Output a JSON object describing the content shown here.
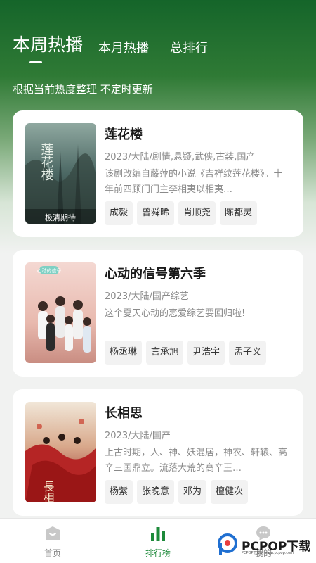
{
  "tabs": [
    {
      "label": "本周热播",
      "active": true
    },
    {
      "label": "本月热播",
      "active": false
    },
    {
      "label": "总排行",
      "active": false
    }
  ],
  "subtitle": "根据当前热度整理 不定时更新",
  "cards": [
    {
      "title": "莲花楼",
      "meta": "2023/大陆/剧情,悬疑,武侠,古装,国产",
      "desc": "        该剧改编自藤萍的小说《吉祥纹莲花楼》。十年前四顾门门主李相夷以相夷…",
      "tags": [
        "成毅",
        "曾舜晞",
        "肖顺尧",
        "陈都灵"
      ],
      "poster_text": [
        "莲花楼",
        "极清期待"
      ]
    },
    {
      "title": "心动的信号第六季",
      "meta": "2023/大陆/国产综艺",
      "desc": "这个夏天心动的恋爱综艺要回归啦!",
      "tags": [
        "杨丞琳",
        "言承旭",
        "尹浩宇",
        "孟子义"
      ],
      "poster_text": [
        "心动的信号"
      ]
    },
    {
      "title": "长相思",
      "meta": "2023/大陆/国产",
      "desc": "上古时期，人、神、妖混居，神农、轩辕、高辛三国鼎立。流落大荒的高辛王…",
      "tags": [
        "杨紫",
        "张晚意",
        "邓为",
        "檀健次"
      ],
      "poster_text": [
        "長相思"
      ]
    }
  ],
  "nav": [
    {
      "label": "首页",
      "icon": "home-icon",
      "active": false
    },
    {
      "label": "排行榜",
      "icon": "chart-icon",
      "active": true
    },
    {
      "label": "我的",
      "icon": "chat-icon",
      "active": false
    }
  ],
  "watermark": {
    "brand": "PCPOP下载",
    "sub": "PCPOP下载站 www.pcpop.com"
  },
  "colors": {
    "accent": "#1d8a3a",
    "header_top": "#15652a"
  }
}
